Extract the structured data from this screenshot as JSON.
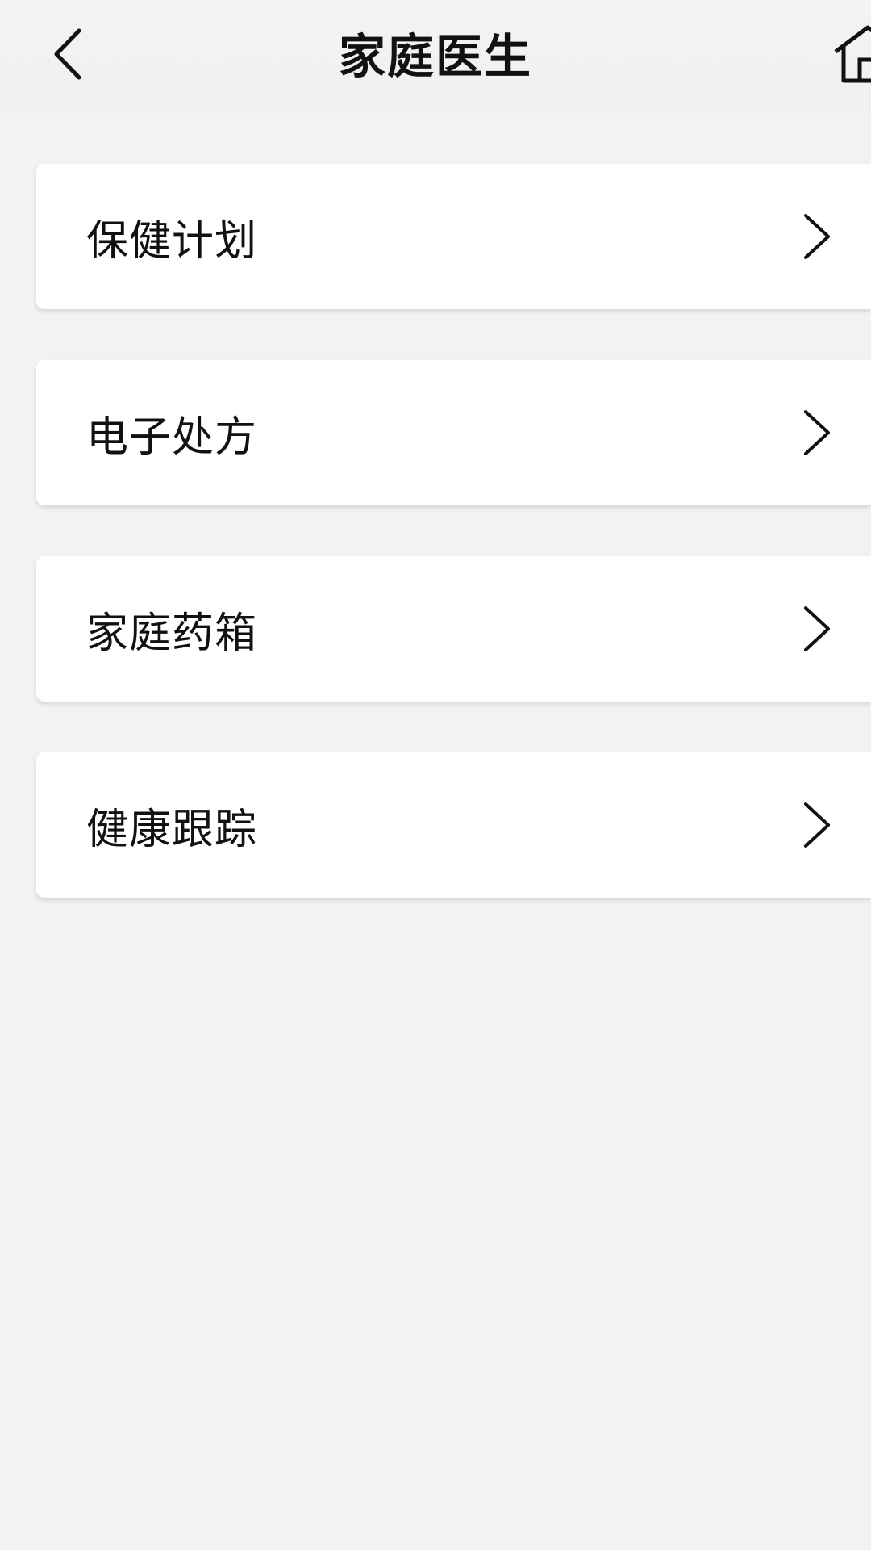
{
  "header": {
    "title": "家庭医生"
  },
  "menu": {
    "items": [
      {
        "label": "保健计划"
      },
      {
        "label": "电子处方"
      },
      {
        "label": "家庭药箱"
      },
      {
        "label": "健康跟踪"
      }
    ]
  },
  "icons": {
    "back": "chevron-left-icon",
    "home": "home-icon",
    "item_arrow": "chevron-right-icon"
  },
  "colors": {
    "background": "#f2f2f2",
    "card": "#ffffff",
    "text": "#111111"
  }
}
